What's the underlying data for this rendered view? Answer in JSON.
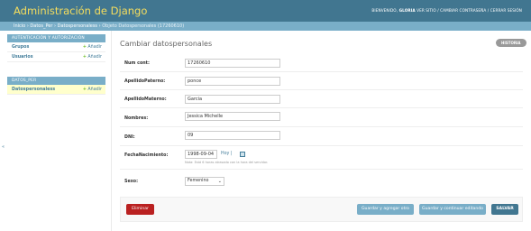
{
  "header": {
    "brand": "Administración de Django",
    "welcome": "BIENVENIDO,",
    "username": "GLORIA",
    "links": "VER SITIO / CAMBIAR CONTRASEÑA / CERRAR SESIÓN"
  },
  "breadcrumb": {
    "home": "Inicio",
    "app": "Datos_Per",
    "model": "Datospersonaless",
    "current": "Objeto Datospersonales (17260610)",
    "separator": "›"
  },
  "sidebar": {
    "toggle": "«",
    "modules": [
      {
        "title": "AUTENTICACIÓN Y AUTORIZACIÓN",
        "items": [
          {
            "label": "Grupos",
            "add": "Añadir"
          },
          {
            "label": "Usuarios",
            "add": "Añadir"
          }
        ]
      },
      {
        "title": "DATOS_PER",
        "items": [
          {
            "label": "Datospersonaless",
            "add": "Añadir"
          }
        ]
      }
    ]
  },
  "main": {
    "title": "Cambiar datospersonales",
    "history": "HISTORIA",
    "fields": {
      "num_cont": {
        "label": "Num cont:",
        "value": "17260610"
      },
      "apellido_paterno": {
        "label": "ApellidoPaterno:",
        "value": "ponce"
      },
      "apellido_materno": {
        "label": "ApellidoMaterno:",
        "value": "Garcia"
      },
      "nombres": {
        "label": "Nombres:",
        "value": "Jessica Michelle"
      },
      "dni": {
        "label": "DNI:",
        "value": "09"
      },
      "fecha": {
        "label": "FechaNacimiento:",
        "value": "1998-09-04",
        "today": "Hoy",
        "sep": "|",
        "help": "Nota: Está 6 horas atrasado con la hora del servidor."
      },
      "sexo": {
        "label": "Sexo:",
        "value": "Femenino"
      }
    }
  },
  "actions": {
    "delete": "Eliminar",
    "save_add": "Guardar y agregar otro",
    "save_continue": "Guardar y continuar editando",
    "save": "SALVAR"
  },
  "colors": {
    "header": "#417690",
    "brand": "#f5dd5d",
    "breadcrumb": "#79aec8",
    "delete": "#ba2121",
    "add_plus": "#70bf2b"
  }
}
